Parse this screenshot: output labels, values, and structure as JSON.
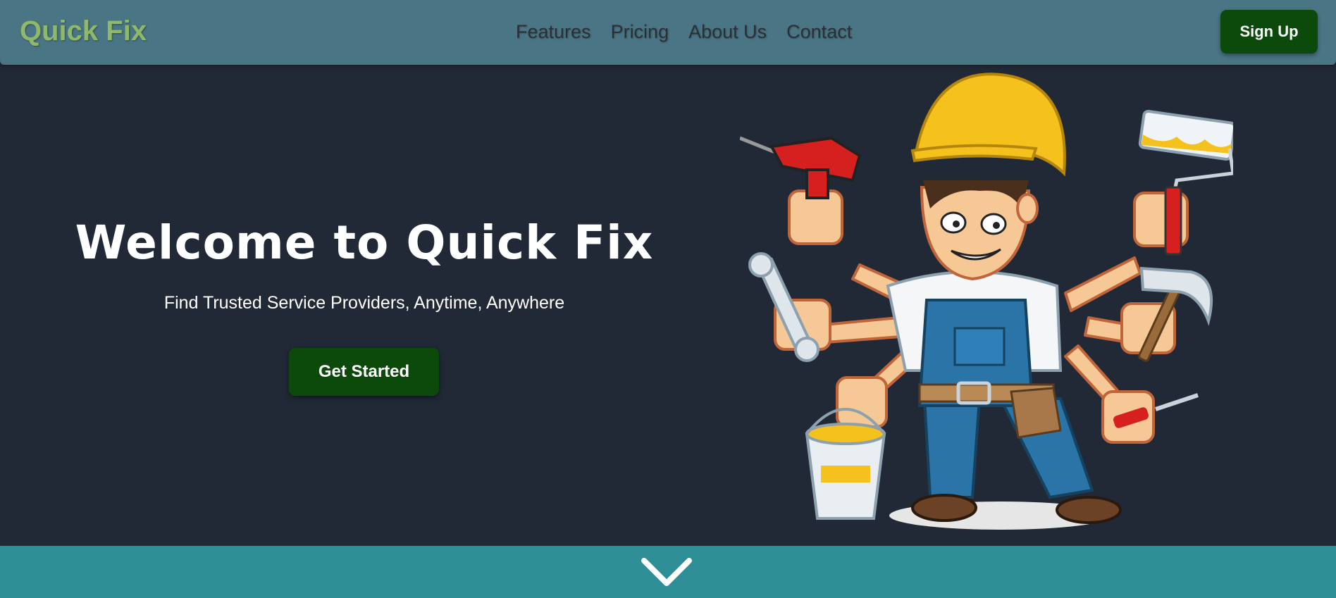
{
  "brand": {
    "name": "Quick Fix"
  },
  "nav": {
    "links": [
      "Features",
      "Pricing",
      "About Us",
      "Contact"
    ],
    "signup_label": "Sign Up"
  },
  "hero": {
    "title": "Welcome to Quick Fix",
    "subtitle": "Find Trusted Service Providers, Anytime, Anywhere",
    "cta_label": "Get Started",
    "illustration_icon": "multi-armed-handyman-illustration"
  },
  "footer": {
    "scroll_icon": "chevron-down-icon"
  },
  "colors": {
    "navbar_bg": "#4a7585",
    "page_bg": "#212937",
    "brand_text": "#8fb96a",
    "button_bg": "#0b4a0b",
    "footer_bg": "#2e8e96"
  }
}
